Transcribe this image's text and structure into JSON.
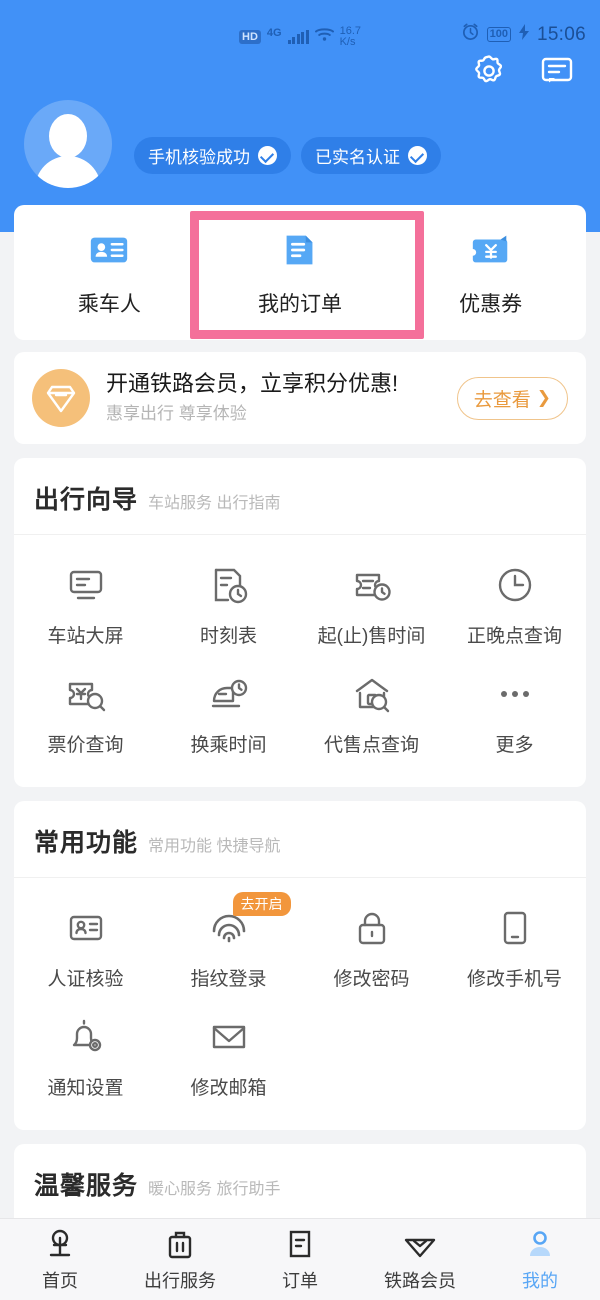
{
  "status_bar": {
    "hd_label": "HD",
    "network_type": "4G",
    "net_speed_value": "16.7",
    "net_speed_unit": "K/s",
    "battery_level": "100",
    "time": "15:06",
    "icons": [
      "alarm-icon",
      "battery-icon",
      "charging-icon"
    ]
  },
  "header": {
    "icons": [
      {
        "name": "gear-icon",
        "label": "设置"
      },
      {
        "name": "message-icon",
        "label": "消息"
      }
    ],
    "avatar_name": "avatar",
    "badges": [
      {
        "label": "手机核验成功",
        "icon": "check-circle-icon"
      },
      {
        "label": "已实名认证",
        "icon": "check-circle-icon"
      }
    ]
  },
  "quick_actions": {
    "items": [
      {
        "label": "乘车人",
        "icon": "id-card-icon",
        "highlighted": false
      },
      {
        "label": "我的订单",
        "icon": "order-document-icon",
        "highlighted": true
      },
      {
        "label": "优惠券",
        "icon": "coupon-wallet-icon",
        "highlighted": false
      }
    ],
    "highlight_color": "#f4709a"
  },
  "member_banner": {
    "icon": "diamond-icon",
    "title": "开通铁路会员，立享积分优惠!",
    "subtitle": "惠享出行 尊享体验",
    "button_label": "去查看",
    "button_chevron": "chevron-right-icon",
    "accent_color": "#e99a3e"
  },
  "sections": [
    {
      "title": "出行向导",
      "subtitle": "车站服务 出行指南",
      "items": [
        {
          "label": "车站大屏",
          "icon": "screen-icon",
          "tag": ""
        },
        {
          "label": "时刻表",
          "icon": "timetable-icon",
          "tag": ""
        },
        {
          "label": "起(止)售时间",
          "icon": "ticket-clock-icon",
          "tag": ""
        },
        {
          "label": "正晚点查询",
          "icon": "clock-icon",
          "tag": ""
        },
        {
          "label": "票价查询",
          "icon": "ticket-search-icon",
          "tag": ""
        },
        {
          "label": "换乘时间",
          "icon": "train-clock-icon",
          "tag": ""
        },
        {
          "label": "代售点查询",
          "icon": "house-search-icon",
          "tag": ""
        },
        {
          "label": "更多",
          "icon": "more-dots-icon",
          "tag": ""
        }
      ]
    },
    {
      "title": "常用功能",
      "subtitle": "常用功能 快捷导航",
      "items": [
        {
          "label": "人证核验",
          "icon": "id-verify-icon",
          "tag": ""
        },
        {
          "label": "指纹登录",
          "icon": "fingerprint-icon",
          "tag": "去开启"
        },
        {
          "label": "修改密码",
          "icon": "lock-icon",
          "tag": ""
        },
        {
          "label": "修改手机号",
          "icon": "phone-icon",
          "tag": ""
        },
        {
          "label": "通知设置",
          "icon": "bell-settings-icon",
          "tag": ""
        },
        {
          "label": "修改邮箱",
          "icon": "envelope-icon",
          "tag": ""
        }
      ]
    }
  ],
  "partial_section": {
    "title": "温馨服务",
    "subtitle": "暖心服务 旅行助手"
  },
  "tabbar": {
    "items": [
      {
        "label": "首页",
        "icon": "railway-logo-icon",
        "active": false
      },
      {
        "label": "出行服务",
        "icon": "suitcase-icon",
        "active": false
      },
      {
        "label": "订单",
        "icon": "order-icon",
        "active": false
      },
      {
        "label": "铁路会员",
        "icon": "diamond-icon",
        "active": false
      },
      {
        "label": "我的",
        "icon": "person-icon",
        "active": true
      }
    ],
    "active_color": "#58a6f5"
  },
  "colors": {
    "header_blue": "#4191f7",
    "page_bg": "#f2f3f5",
    "card_bg": "#ffffff",
    "highlight_pink": "#f4709a",
    "orange": "#f2963c",
    "icon_blue": "#56a8f5"
  }
}
